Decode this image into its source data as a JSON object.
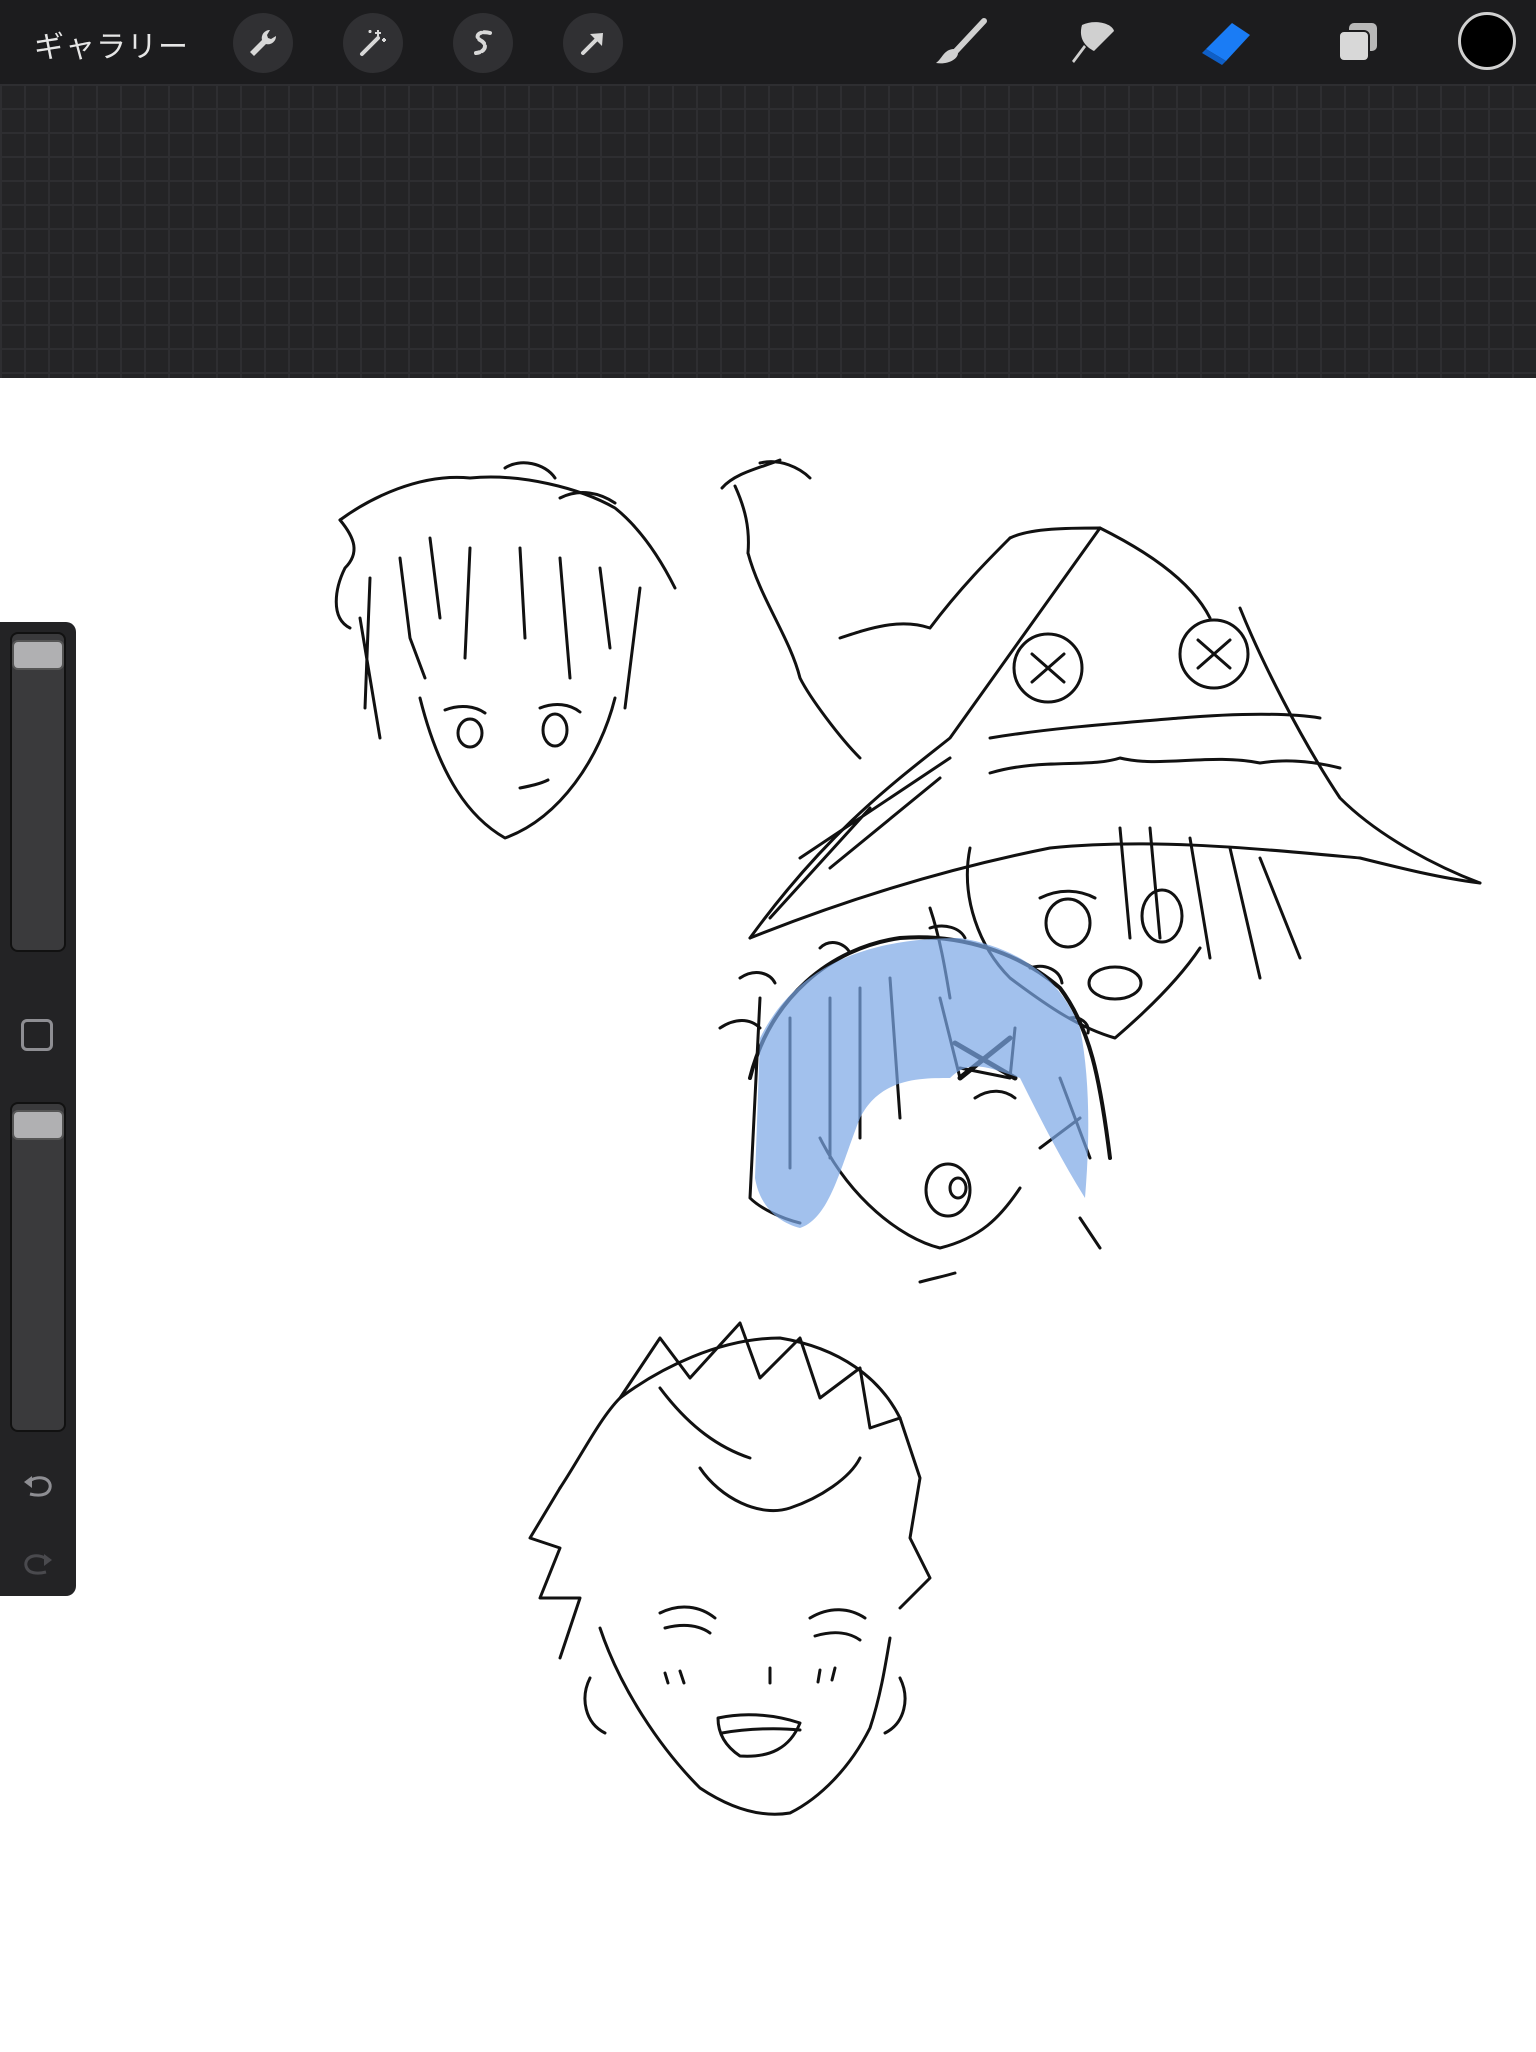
{
  "toolbar": {
    "gallery_label": "ギャラリー",
    "left_tools": [
      {
        "name": "actions",
        "icon": "wrench-icon"
      },
      {
        "name": "adjustments",
        "icon": "magic-wand-icon"
      },
      {
        "name": "selection",
        "icon": "selection-s-icon"
      },
      {
        "name": "transform",
        "icon": "arrow-cursor-icon"
      }
    ],
    "right_tools": [
      {
        "name": "brush",
        "icon": "brush-icon",
        "active": false
      },
      {
        "name": "smudge",
        "icon": "smudge-icon",
        "active": false
      },
      {
        "name": "eraser",
        "icon": "eraser-icon",
        "active": true
      },
      {
        "name": "layers",
        "icon": "layers-icon",
        "active": false
      }
    ],
    "current_color": "#000000"
  },
  "sidebar": {
    "brush_size_level": 0.0,
    "opacity_level": 0.0,
    "modify_icon": "square-icon",
    "undo_icon": "undo-icon",
    "redo_icon": "redo-icon"
  },
  "colors": {
    "accent": "#1a7cf5",
    "toolbar_bg": "#1c1c1e",
    "sketch_fill": "#7aa6e6"
  }
}
